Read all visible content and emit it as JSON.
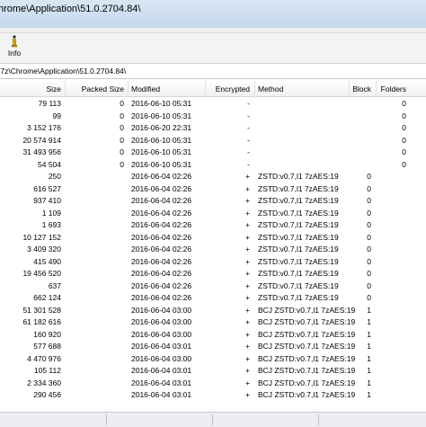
{
  "window": {
    "title": "hrome\\Application\\51.0.2704.84\\"
  },
  "toolbar": {
    "info_label": "Info"
  },
  "address": {
    "path": ".7z\\Chrome\\Application\\51.0.2704.84\\"
  },
  "columns": {
    "size": "Size",
    "packed": "Packed Size",
    "modified": "Modified",
    "encrypted": "Encrypted",
    "method": "Method",
    "block": "Block",
    "folders": "Folders"
  },
  "rows": [
    {
      "size": "79 113",
      "packed": "0",
      "modified": "2016-06-10 05:31",
      "encrypted": "-",
      "method": "",
      "block": "",
      "folders": "0"
    },
    {
      "size": "99",
      "packed": "0",
      "modified": "2016-06-10 05:31",
      "encrypted": "-",
      "method": "",
      "block": "",
      "folders": "0"
    },
    {
      "size": "3 152 176",
      "packed": "0",
      "modified": "2016-06-20 22:31",
      "encrypted": "-",
      "method": "",
      "block": "",
      "folders": "0"
    },
    {
      "size": "20 574 914",
      "packed": "0",
      "modified": "2016-06-10 05:31",
      "encrypted": "-",
      "method": "",
      "block": "",
      "folders": "0"
    },
    {
      "size": "31 493 956",
      "packed": "0",
      "modified": "2016-06-10 05:31",
      "encrypted": "-",
      "method": "",
      "block": "",
      "folders": "0"
    },
    {
      "size": "54 504",
      "packed": "0",
      "modified": "2016-06-10 05:31",
      "encrypted": "-",
      "method": "",
      "block": "",
      "folders": "0"
    },
    {
      "size": "250",
      "packed": "",
      "modified": "2016-06-04 02:26",
      "encrypted": "+",
      "method": "ZSTD:v0.7,l1 7zAES:19",
      "block": "0",
      "folders": ""
    },
    {
      "size": "616 527",
      "packed": "",
      "modified": "2016-06-04 02:26",
      "encrypted": "+",
      "method": "ZSTD:v0.7,l1 7zAES:19",
      "block": "0",
      "folders": ""
    },
    {
      "size": "937 410",
      "packed": "",
      "modified": "2016-06-04 02:26",
      "encrypted": "+",
      "method": "ZSTD:v0.7,l1 7zAES:19",
      "block": "0",
      "folders": ""
    },
    {
      "size": "1 109",
      "packed": "",
      "modified": "2016-06-04 02:26",
      "encrypted": "+",
      "method": "ZSTD:v0.7,l1 7zAES:19",
      "block": "0",
      "folders": ""
    },
    {
      "size": "1 693",
      "packed": "",
      "modified": "2016-06-04 02:26",
      "encrypted": "+",
      "method": "ZSTD:v0.7,l1 7zAES:19",
      "block": "0",
      "folders": ""
    },
    {
      "size": "10 127 152",
      "packed": "",
      "modified": "2016-06-04 02:26",
      "encrypted": "+",
      "method": "ZSTD:v0.7,l1 7zAES:19",
      "block": "0",
      "folders": ""
    },
    {
      "size": "3 409 320",
      "packed": "",
      "modified": "2016-06-04 02:26",
      "encrypted": "+",
      "method": "ZSTD:v0.7,l1 7zAES:19",
      "block": "0",
      "folders": ""
    },
    {
      "size": "415 490",
      "packed": "",
      "modified": "2016-06-04 02:26",
      "encrypted": "+",
      "method": "ZSTD:v0.7,l1 7zAES:19",
      "block": "0",
      "folders": ""
    },
    {
      "size": "19 456 520",
      "packed": "",
      "modified": "2016-06-04 02:26",
      "encrypted": "+",
      "method": "ZSTD:v0.7,l1 7zAES:19",
      "block": "0",
      "folders": ""
    },
    {
      "size": "637",
      "packed": "",
      "modified": "2016-06-04 02:26",
      "encrypted": "+",
      "method": "ZSTD:v0.7,l1 7zAES:19",
      "block": "0",
      "folders": ""
    },
    {
      "size": "662 124",
      "packed": "",
      "modified": "2016-06-04 02:26",
      "encrypted": "+",
      "method": "ZSTD:v0.7,l1 7zAES:19",
      "block": "0",
      "folders": ""
    },
    {
      "size": "51 301 528",
      "packed": "",
      "modified": "2016-06-04 03:00",
      "encrypted": "+",
      "method": "BCJ ZSTD:v0.7,l1 7zAES:19",
      "block": "1",
      "folders": ""
    },
    {
      "size": "61 182 616",
      "packed": "",
      "modified": "2016-06-04 03:00",
      "encrypted": "+",
      "method": "BCJ ZSTD:v0.7,l1 7zAES:19",
      "block": "1",
      "folders": ""
    },
    {
      "size": "160 920",
      "packed": "",
      "modified": "2016-06-04 03:00",
      "encrypted": "+",
      "method": "BCJ ZSTD:v0.7,l1 7zAES:19",
      "block": "1",
      "folders": ""
    },
    {
      "size": "577 688",
      "packed": "",
      "modified": "2016-06-04 03:01",
      "encrypted": "+",
      "method": "BCJ ZSTD:v0.7,l1 7zAES:19",
      "block": "1",
      "folders": ""
    },
    {
      "size": "4 470 976",
      "packed": "",
      "modified": "2016-06-04 03:00",
      "encrypted": "+",
      "method": "BCJ ZSTD:v0.7,l1 7zAES:19",
      "block": "1",
      "folders": ""
    },
    {
      "size": "105 112",
      "packed": "",
      "modified": "2016-06-04 03:01",
      "encrypted": "+",
      "method": "BCJ ZSTD:v0.7,l1 7zAES:19",
      "block": "1",
      "folders": ""
    },
    {
      "size": "2 334 360",
      "packed": "",
      "modified": "2016-06-04 03:01",
      "encrypted": "+",
      "method": "BCJ ZSTD:v0.7,l1 7zAES:19",
      "block": "1",
      "folders": ""
    },
    {
      "size": "290 456",
      "packed": "",
      "modified": "2016-06-04 03:01",
      "encrypted": "+",
      "method": "BCJ ZSTD:v0.7,l1 7zAES:19",
      "block": "1",
      "folders": ""
    }
  ]
}
